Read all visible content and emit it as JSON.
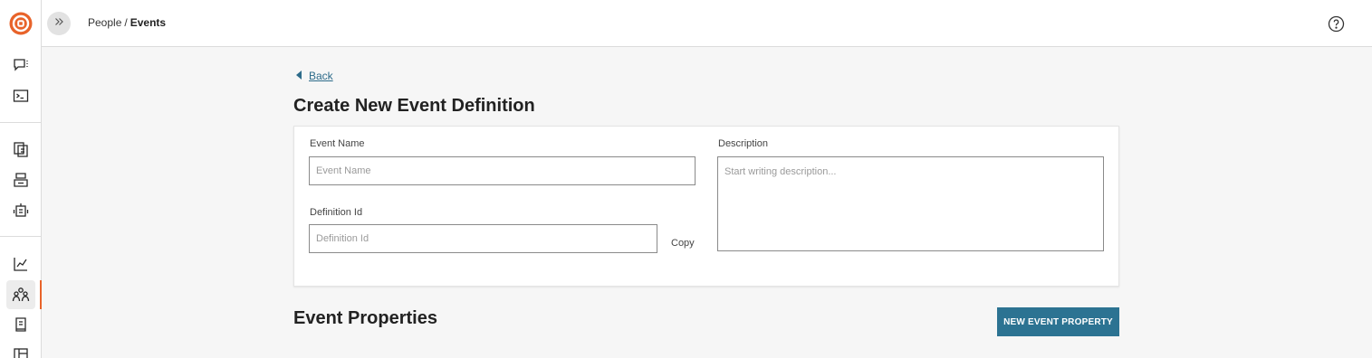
{
  "breadcrumb": {
    "parent": "People",
    "separator": "/",
    "current": "Events"
  },
  "back": {
    "label": "Back"
  },
  "page": {
    "title": "Create New Event Definition"
  },
  "form": {
    "event_name": {
      "label": "Event Name",
      "placeholder": "Event Name",
      "value": ""
    },
    "definition_id": {
      "label": "Definition Id",
      "placeholder": "Definition Id",
      "value": ""
    },
    "copy_label": "Copy",
    "description": {
      "label": "Description",
      "placeholder": "Start writing description...",
      "value": ""
    }
  },
  "properties": {
    "title": "Event Properties",
    "new_button": "NEW EVENT PROPERTY"
  },
  "colors": {
    "accent": "#e8632a",
    "primary_button": "#2c7392",
    "link": "#2d6b8a"
  },
  "sidebar": {
    "icons": [
      "logo-icon",
      "chat-icon",
      "terminal-icon",
      "documents-icon",
      "stacks-icon",
      "robot-icon",
      "chart-icon",
      "people-icon",
      "book-icon",
      "layout-icon"
    ],
    "active": "people-icon"
  }
}
